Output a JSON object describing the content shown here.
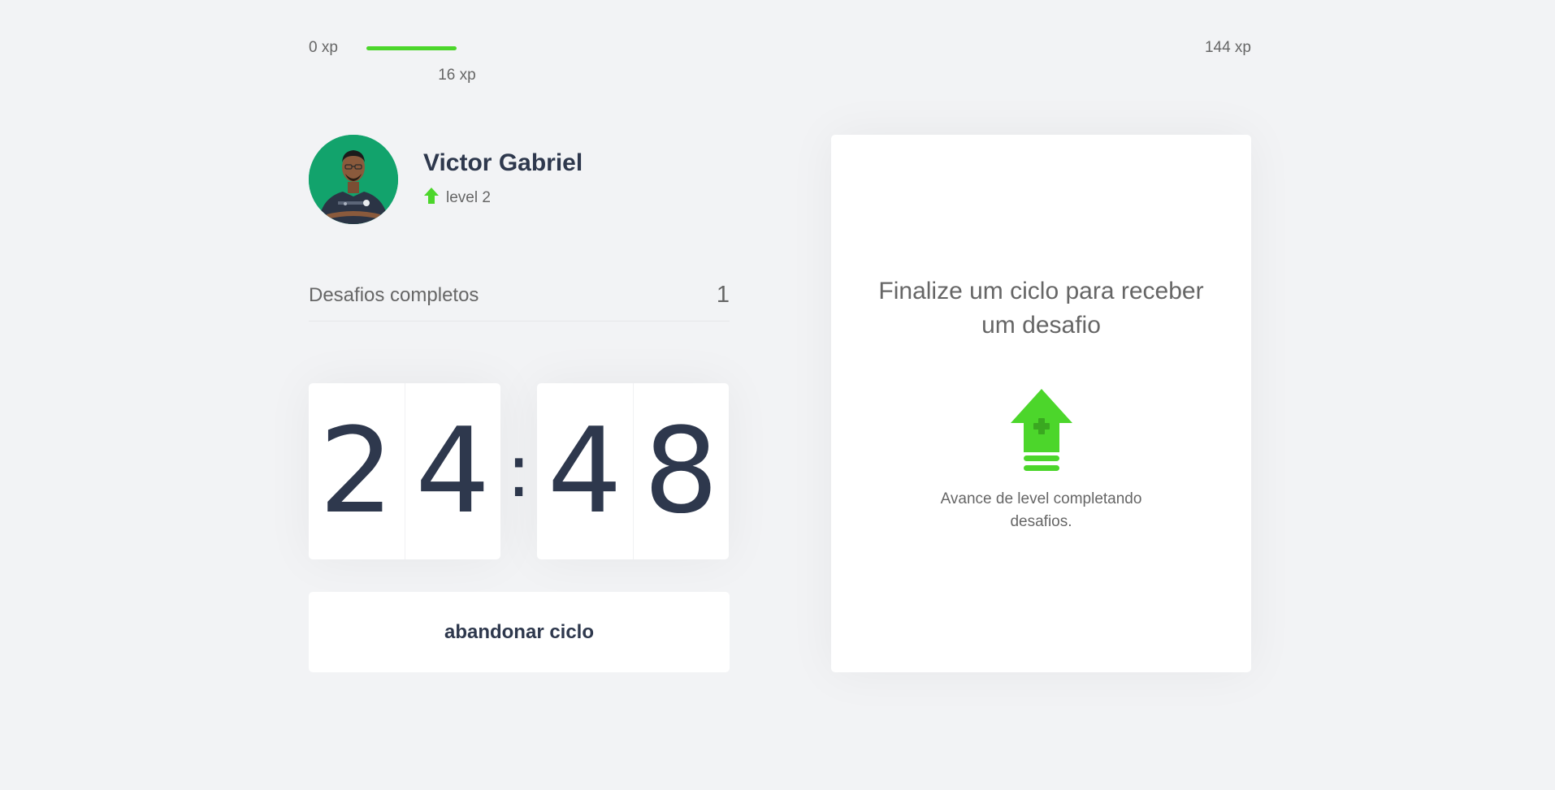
{
  "experience": {
    "start_label": "0 xp",
    "current_label": "16 xp",
    "end_label": "144 xp",
    "current_value": 16,
    "max_value": 144,
    "fill_color": "#4cd62b"
  },
  "profile": {
    "name": "Victor Gabriel",
    "level_label": "level 2",
    "level_icon": "level-up-arrow-icon",
    "avatar_icon": "user-avatar"
  },
  "completed_challenges": {
    "label": "Desafios completos",
    "value": "1"
  },
  "countdown": {
    "minute_left": "2",
    "minute_right": "4",
    "separator": ":",
    "second_left": "4",
    "second_right": "8"
  },
  "actions": {
    "abandon_label": "abandonar ciclo"
  },
  "challenge_box": {
    "title": "Finalize um ciclo para receber um desafio",
    "icon": "level-up-icon",
    "description": "Avance de level completando desafios."
  },
  "colors": {
    "background": "#f2f3f5",
    "card": "#ffffff",
    "title": "#2e384d",
    "text": "#666666",
    "green": "#4cd62b"
  }
}
